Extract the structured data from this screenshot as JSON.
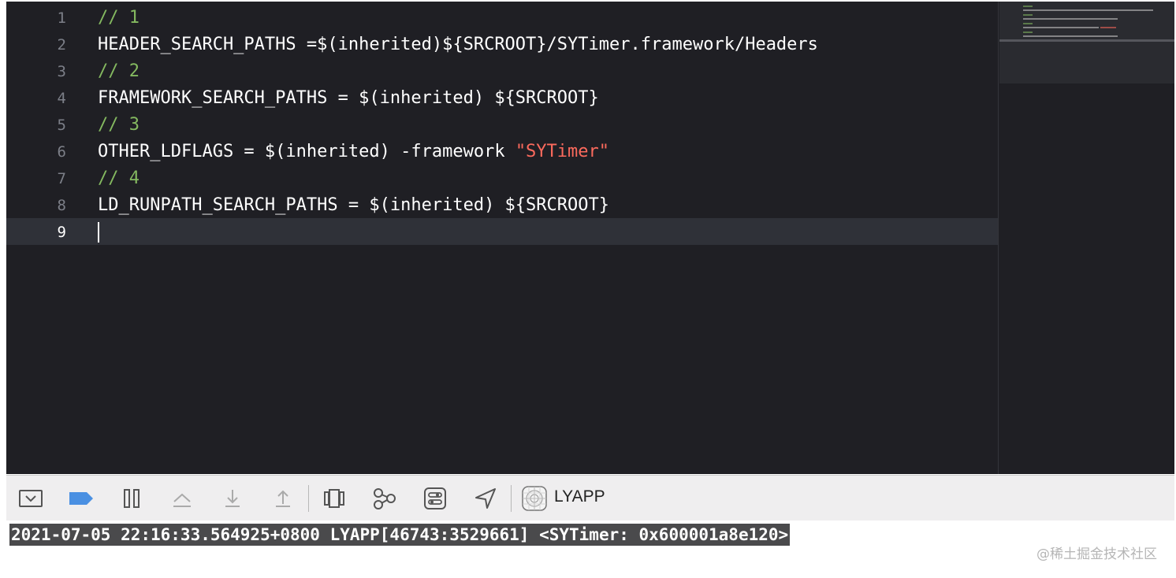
{
  "editor": {
    "line_numbers": [
      "1",
      "2",
      "3",
      "4",
      "5",
      "6",
      "7",
      "8",
      "9"
    ],
    "current_line": "9",
    "lines": [
      {
        "n": "1",
        "segments": [
          {
            "t": "// 1",
            "k": "comment"
          }
        ]
      },
      {
        "n": "2",
        "segments": [
          {
            "t": "HEADER_SEARCH_PATHS =$(inherited)${SRCROOT}/SYTimer.framework/Headers",
            "k": "plain"
          }
        ]
      },
      {
        "n": "3",
        "segments": [
          {
            "t": "// 2",
            "k": "comment"
          }
        ]
      },
      {
        "n": "4",
        "segments": [
          {
            "t": "FRAMEWORK_SEARCH_PATHS = $(inherited) ${SRCROOT}",
            "k": "plain"
          }
        ]
      },
      {
        "n": "5",
        "segments": [
          {
            "t": "// 3",
            "k": "comment"
          }
        ]
      },
      {
        "n": "6",
        "segments": [
          {
            "t": "OTHER_LDFLAGS = $(inherited) -framework ",
            "k": "plain"
          },
          {
            "t": "\"SYTimer\"",
            "k": "str"
          }
        ]
      },
      {
        "n": "7",
        "segments": [
          {
            "t": "// 4",
            "k": "comment"
          }
        ]
      },
      {
        "n": "8",
        "segments": [
          {
            "t": "LD_RUNPATH_SEARCH_PATHS = $(inherited) ${SRCROOT}",
            "k": "plain"
          }
        ]
      },
      {
        "n": "9",
        "segments": []
      }
    ]
  },
  "colors": {
    "editor_bg": "#1f1f24",
    "comment": "#84b960",
    "string": "#fc6a5d",
    "plain": "#ffffff",
    "current_line_bg": "#2f3138",
    "breakpoint_accent": "#4a90e2"
  },
  "debug_toolbar": {
    "buttons": [
      {
        "icon": "hide-debug-area-icon"
      },
      {
        "icon": "breakpoints-toggle-icon"
      },
      {
        "icon": "pause-icon"
      },
      {
        "icon": "step-over-icon"
      },
      {
        "icon": "step-into-icon"
      },
      {
        "icon": "step-out-icon"
      },
      {
        "icon": "debug-view-hierarchy-icon"
      },
      {
        "icon": "memory-graph-icon"
      },
      {
        "icon": "environment-overrides-icon"
      },
      {
        "icon": "simulate-location-icon"
      },
      {
        "icon": "process-app-icon"
      }
    ],
    "process_label": "LYAPP"
  },
  "console": {
    "log_line": "2021-07-05 22:16:33.564925+0800 LYAPP[46743:3529661] <SYTimer: 0x600001a8e120>"
  },
  "watermark": "@稀土掘金技术社区"
}
